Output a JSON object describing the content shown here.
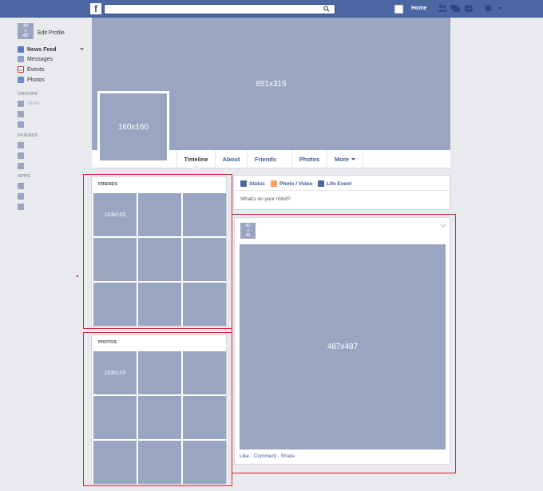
{
  "topbar": {
    "logo": "f",
    "search": {
      "value": "",
      "placeholder": ""
    },
    "home_label": "Home",
    "icons": [
      "friends-icon",
      "messages-icon",
      "notifications-icon",
      "settings-icon"
    ]
  },
  "sidebar": {
    "edit_profile": {
      "avatar": "40\nx\n40",
      "label": "Edit Profile"
    },
    "nav": [
      {
        "label": "News Feed",
        "icon": "news-feed-icon"
      },
      {
        "label": "Messages",
        "icon": "messages-icon"
      },
      {
        "label": "Events",
        "icon": "events-icon",
        "badge": "24"
      },
      {
        "label": "Photos",
        "icon": "photos-icon"
      }
    ],
    "groups_title": "GROUPS",
    "group_first_label": "16x16",
    "friends_title": "FRIENDS",
    "apps_title": "APPS"
  },
  "cover": {
    "label": "851x315"
  },
  "profile_picture": {
    "label": "160x160"
  },
  "tabs": [
    "Timeline",
    "About",
    "Friends",
    "Photos",
    "More"
  ],
  "friends_card": {
    "title": "FRIENDS",
    "first_cell": "103x103"
  },
  "photos_card": {
    "title": "PHOTOS",
    "first_cell": "103x103"
  },
  "composer": {
    "tabs": [
      "Status",
      "Photo / Video",
      "Life Event"
    ],
    "placeholder": "What's on your mind?"
  },
  "post": {
    "avatar_label": "40\nx\n40",
    "image_label": "487x487",
    "actions": "Like · Comment · Share"
  },
  "colors": {
    "brand": "#4b66a0",
    "placeholder": "#9aa5c2",
    "highlight_border": "#d0282f",
    "link": "#3b5998"
  }
}
